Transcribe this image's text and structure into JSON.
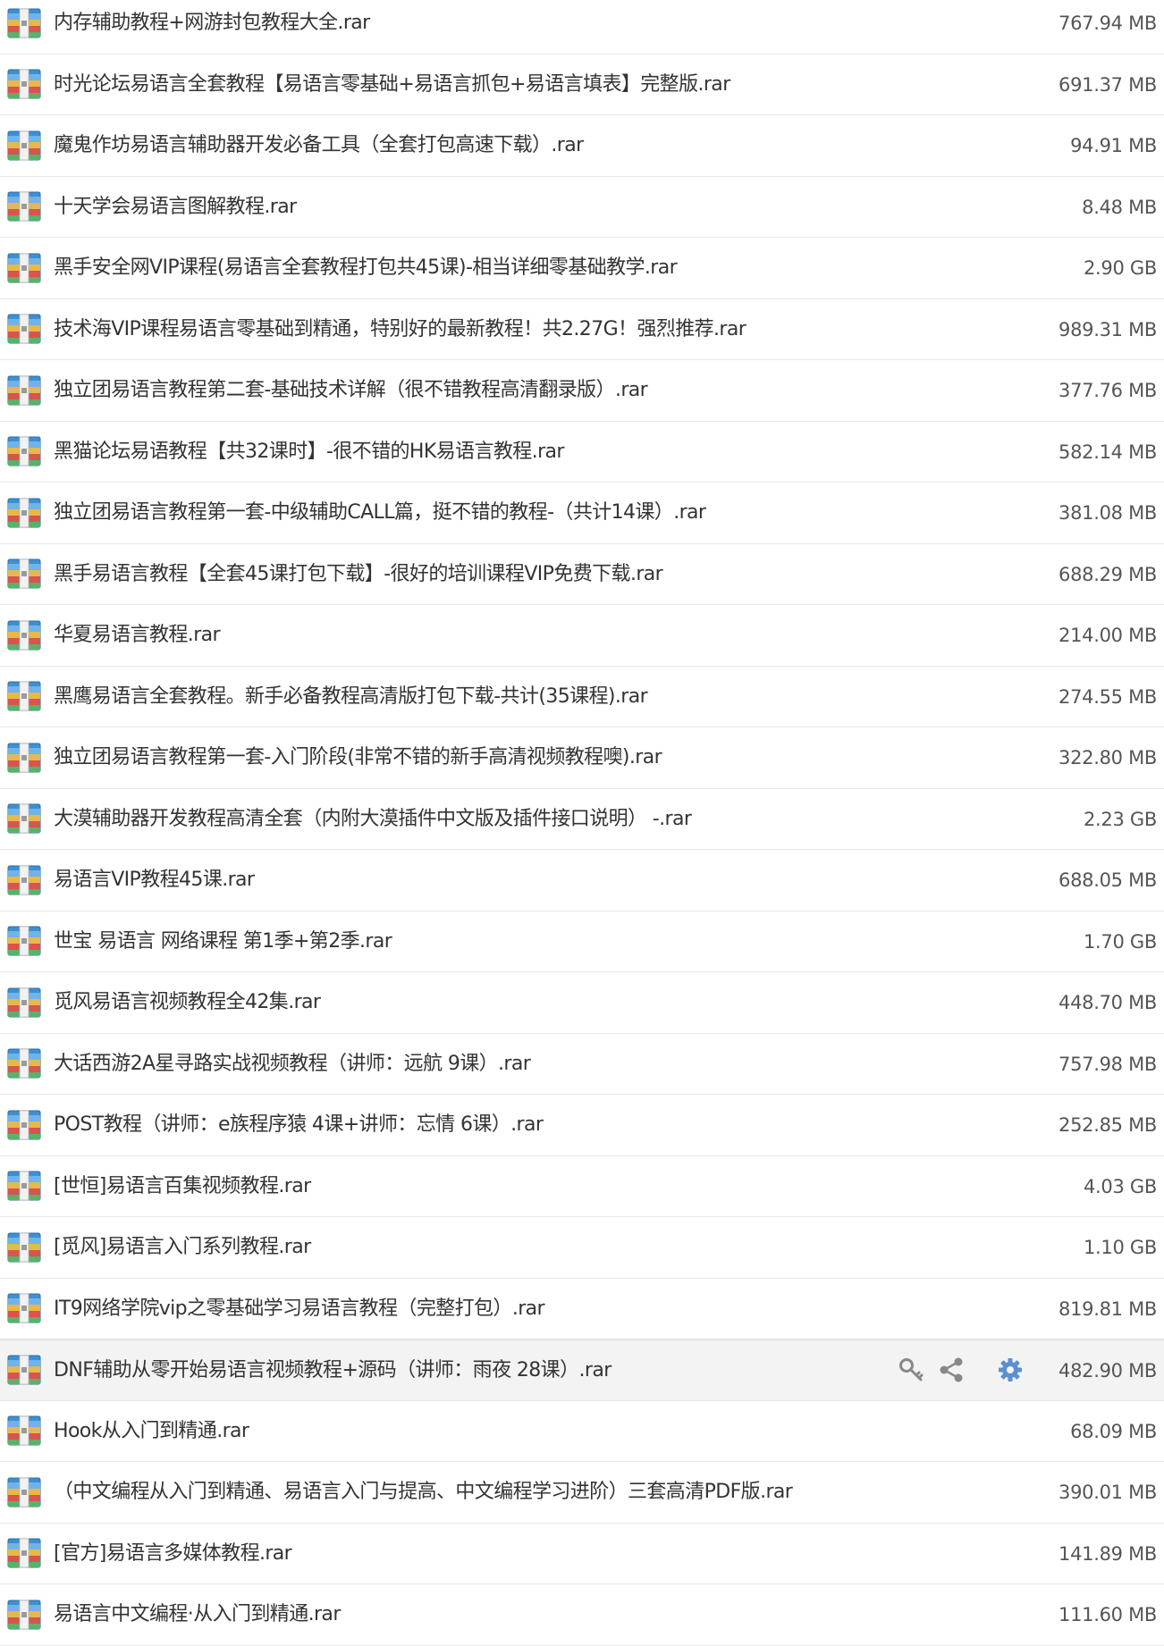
{
  "colors": {
    "row_border": "#e7e7e7",
    "hover_background": "#f3f3f3",
    "action_gray": "#888888",
    "settings_blue": "#5b8fd0"
  },
  "icons": {
    "file_icon": "rar-archive-icon",
    "row_actions": [
      "key-icon",
      "share-icon",
      "gear-icon"
    ]
  },
  "hovered_row_index": 22,
  "files": [
    {
      "name": "内存辅助教程+网游封包教程大全.rar",
      "size": "767.94 MB"
    },
    {
      "name": "时光论坛易语言全套教程【易语言零基础+易语言抓包+易语言填表】完整版.rar",
      "size": "691.37 MB"
    },
    {
      "name": "魔鬼作坊易语言辅助器开发必备工具（全套打包高速下载）.rar",
      "size": "94.91 MB"
    },
    {
      "name": "十天学会易语言图解教程.rar",
      "size": "8.48 MB"
    },
    {
      "name": "黑手安全网VIP课程(易语言全套教程打包共45课)-相当详细零基础教学.rar",
      "size": "2.90 GB"
    },
    {
      "name": "技术海VIP课程易语言零基础到精通，特别好的最新教程！共2.27G！强烈推荐.rar",
      "size": "989.31 MB"
    },
    {
      "name": "独立团易语言教程第二套-基础技术详解（很不错教程高清翻录版）.rar",
      "size": "377.76 MB"
    },
    {
      "name": "黑猫论坛易语教程【共32课时】-很不错的HK易语言教程.rar",
      "size": "582.14 MB"
    },
    {
      "name": "独立团易语言教程第一套-中级辅助CALL篇，挺不错的教程-（共计14课）.rar",
      "size": "381.08 MB"
    },
    {
      "name": "黑手易语言教程【全套45课打包下载】-很好的培训课程VIP免费下载.rar",
      "size": "688.29 MB"
    },
    {
      "name": "华夏易语言教程.rar",
      "size": "214.00 MB"
    },
    {
      "name": "黑鹰易语言全套教程。新手必备教程高清版打包下载-共计(35课程).rar",
      "size": "274.55 MB"
    },
    {
      "name": "独立团易语言教程第一套-入门阶段(非常不错的新手高清视频教程噢).rar",
      "size": "322.80 MB"
    },
    {
      "name": "大漠辅助器开发教程高清全套（内附大漠插件中文版及插件接口说明） -.rar",
      "size": "2.23 GB"
    },
    {
      "name": "易语言VIP教程45课.rar",
      "size": "688.05 MB"
    },
    {
      "name": "世宝 易语言 网络课程 第1季+第2季.rar",
      "size": "1.70 GB"
    },
    {
      "name": "觅风易语言视频教程全42集.rar",
      "size": "448.70 MB"
    },
    {
      "name": "大话西游2A星寻路实战视频教程（讲师：远航 9课）.rar",
      "size": "757.98 MB"
    },
    {
      "name": "POST教程（讲师：e族程序猿 4课+讲师：忘情 6课）.rar",
      "size": "252.85 MB"
    },
    {
      "name": "[世恒]易语言百集视频教程.rar",
      "size": "4.03 GB"
    },
    {
      "name": "[觅风]易语言入门系列教程.rar",
      "size": "1.10 GB"
    },
    {
      "name": "IT9网络学院vip之零基础学习易语言教程（完整打包）.rar",
      "size": "819.81 MB"
    },
    {
      "name": "DNF辅助从零开始易语言视频教程+源码（讲师：雨夜 28课）.rar",
      "size": "482.90 MB"
    },
    {
      "name": "Hook从入门到精通.rar",
      "size": "68.09 MB"
    },
    {
      "name": "（中文编程从入门到精通、易语言入门与提高、中文编程学习进阶）三套高清PDF版.rar",
      "size": "390.01 MB"
    },
    {
      "name": "[官方]易语言多媒体教程.rar",
      "size": "141.89 MB"
    },
    {
      "name": "易语言中文编程·从入门到精通.rar",
      "size": "111.60 MB"
    }
  ]
}
